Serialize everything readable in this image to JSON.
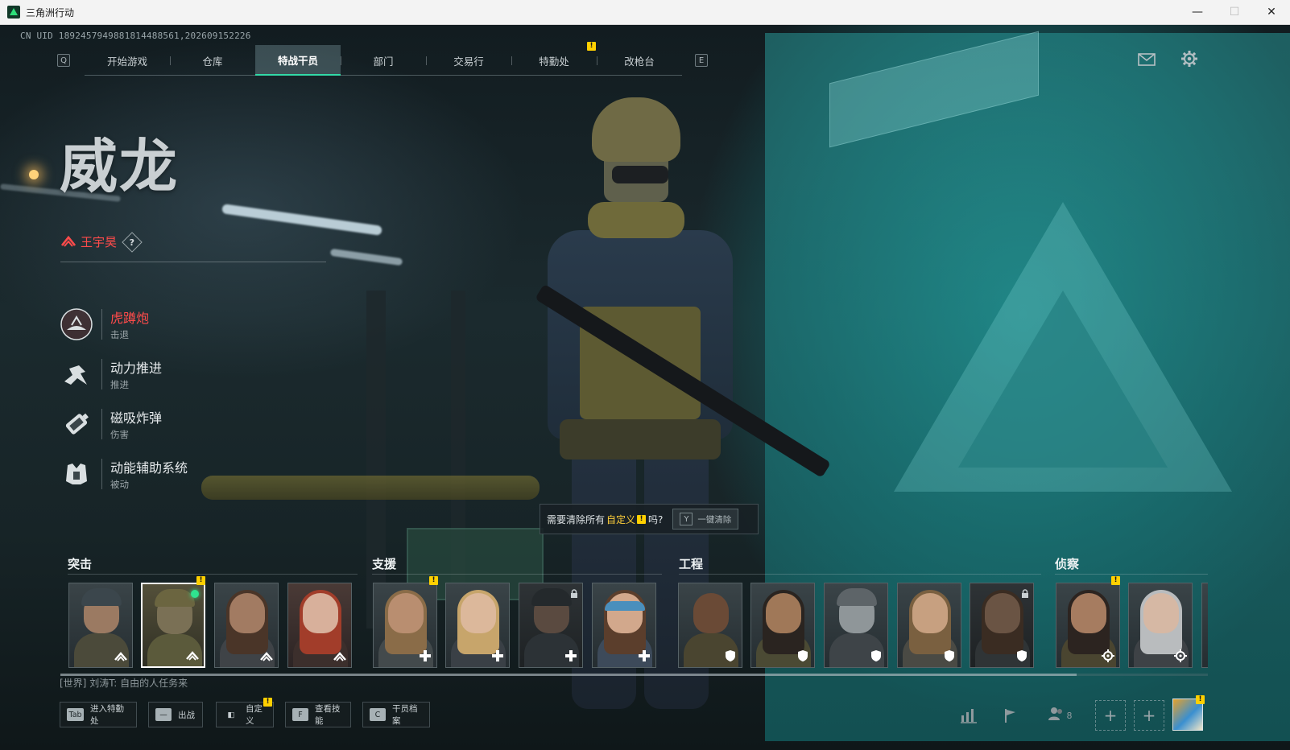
{
  "window": {
    "title": "三角洲行动",
    "controls": {
      "minimize": "—",
      "maximize": "☐",
      "close": "✕"
    }
  },
  "uid": "CN UID 1892457949881814488561,202609152226",
  "nav": {
    "prev_key": "Q",
    "next_key": "E",
    "tabs": [
      {
        "label": "开始游戏",
        "active": false
      },
      {
        "label": "仓库",
        "active": false
      },
      {
        "label": "特战干员",
        "active": true
      },
      {
        "label": "部门",
        "active": false
      },
      {
        "label": "交易行",
        "active": false
      },
      {
        "label": "特勤处",
        "active": false,
        "badge": "!"
      },
      {
        "label": "改枪台",
        "active": false
      }
    ]
  },
  "top_right_icons": [
    "mail-icon",
    "gear-icon"
  ],
  "operator": {
    "codename": "威龙",
    "real_name": "王宇昊",
    "help": "?",
    "skills": [
      {
        "name": "虎蹲炮",
        "type": "击退",
        "icon": "mortar-icon",
        "active": true
      },
      {
        "name": "动力推进",
        "type": "推进",
        "icon": "dash-icon",
        "active": false
      },
      {
        "name": "磁吸炸弹",
        "type": "伤害",
        "icon": "bomb-icon",
        "active": false
      },
      {
        "name": "动能辅助系统",
        "type": "被动",
        "icon": "exosuit-icon",
        "active": false
      }
    ]
  },
  "prompt": {
    "text_before": "需要清除所有",
    "highlight": "自定义",
    "badge": "!",
    "text_after": "吗?",
    "key": "Y",
    "button_label": "一键清除"
  },
  "roster": {
    "categories": [
      {
        "label": "突击",
        "role_icon": "assault-chevron-icon"
      },
      {
        "label": "支援",
        "role_icon": "support-cross-icon"
      },
      {
        "label": "工程",
        "role_icon": "engineer-shield-icon"
      },
      {
        "label": "侦察",
        "role_icon": "recon-target-icon"
      }
    ],
    "badge": "!"
  },
  "chat": {
    "channel": "[世界]",
    "sender": "刘涛T:",
    "message": "自由的人任务来"
  },
  "bottom_actions": [
    {
      "key": "Tab",
      "label": "进入特勤处"
    },
    {
      "key": "—",
      "label": "出战"
    },
    {
      "key": "◧",
      "label": "自定义",
      "badge": "!"
    },
    {
      "key": "F",
      "label": "查看技能"
    },
    {
      "key": "C",
      "label": "干员档案"
    }
  ],
  "bottom_right": {
    "icons": [
      "stats-icon",
      "flag-icon",
      "friends-icon"
    ],
    "friends_count": "8",
    "add": "+"
  },
  "colors": {
    "accent": "#32d9a7",
    "danger": "#ff4b4b",
    "warning": "#ffd000",
    "teal_bg": "#1f9896"
  }
}
